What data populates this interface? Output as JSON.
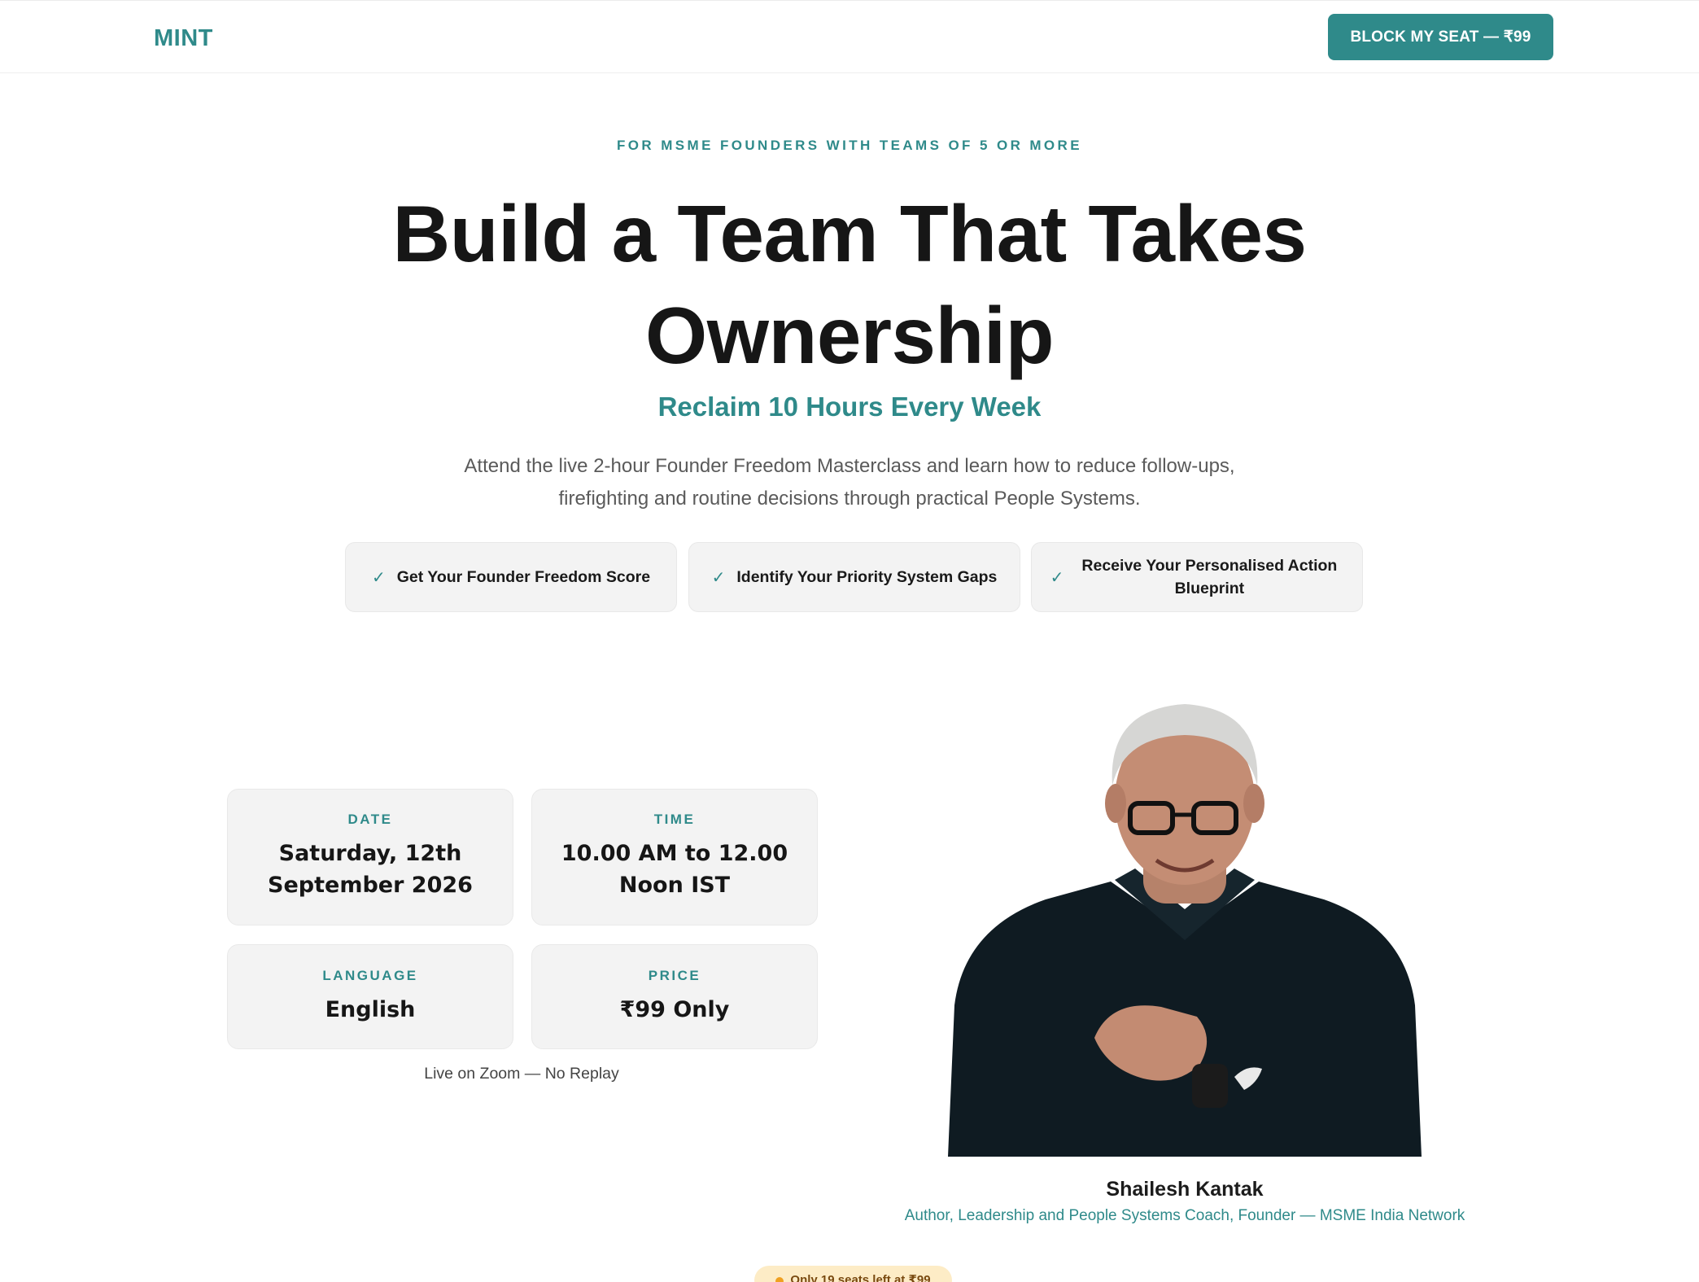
{
  "nav": {
    "logo": "MINT",
    "cta_label": "BLOCK MY SEAT — ₹99"
  },
  "hero": {
    "eyebrow": "FOR MSME FOUNDERS WITH TEAMS OF 5 OR MORE",
    "headline_line1": "Build a Team That Takes",
    "headline_line2": "Ownership",
    "subheadline": "Reclaim 10 Hours Every Week",
    "description_line1": "Attend the live 2-hour Founder Freedom Masterclass and learn how to reduce follow-ups,",
    "description_line2": "firefighting and routine decisions through practical People Systems."
  },
  "benefits": [
    {
      "icon": "check-icon",
      "label": "Get Your Founder Freedom Score"
    },
    {
      "icon": "check-icon",
      "label": "Identify Your Priority System Gaps"
    },
    {
      "icon": "check-icon",
      "label": "Receive Your Personalised Action Blueprint"
    }
  ],
  "details": {
    "date": {
      "caption": "DATE",
      "line1": "Saturday, 12th",
      "line2": "September 2026"
    },
    "time": {
      "caption": "TIME",
      "line1": "10.00 AM to 12.00",
      "line2": "Noon IST"
    },
    "language": {
      "caption": "LANGUAGE",
      "value": "English"
    },
    "price": {
      "caption": "PRICE",
      "value": "₹99 Only"
    },
    "note": "Live on Zoom — No Replay"
  },
  "speaker": {
    "name": "Shailesh Kantak",
    "role": "Author, Leadership and People Systems Coach, Founder — MSME India Network"
  },
  "urgency": {
    "text": "Only 19 seats left at ₹99"
  },
  "colors": {
    "accent": "#2f8a8a",
    "card_bg": "#f3f3f3",
    "urgency_bg": "#fdecc6",
    "urgency_dot": "#f0a020"
  }
}
